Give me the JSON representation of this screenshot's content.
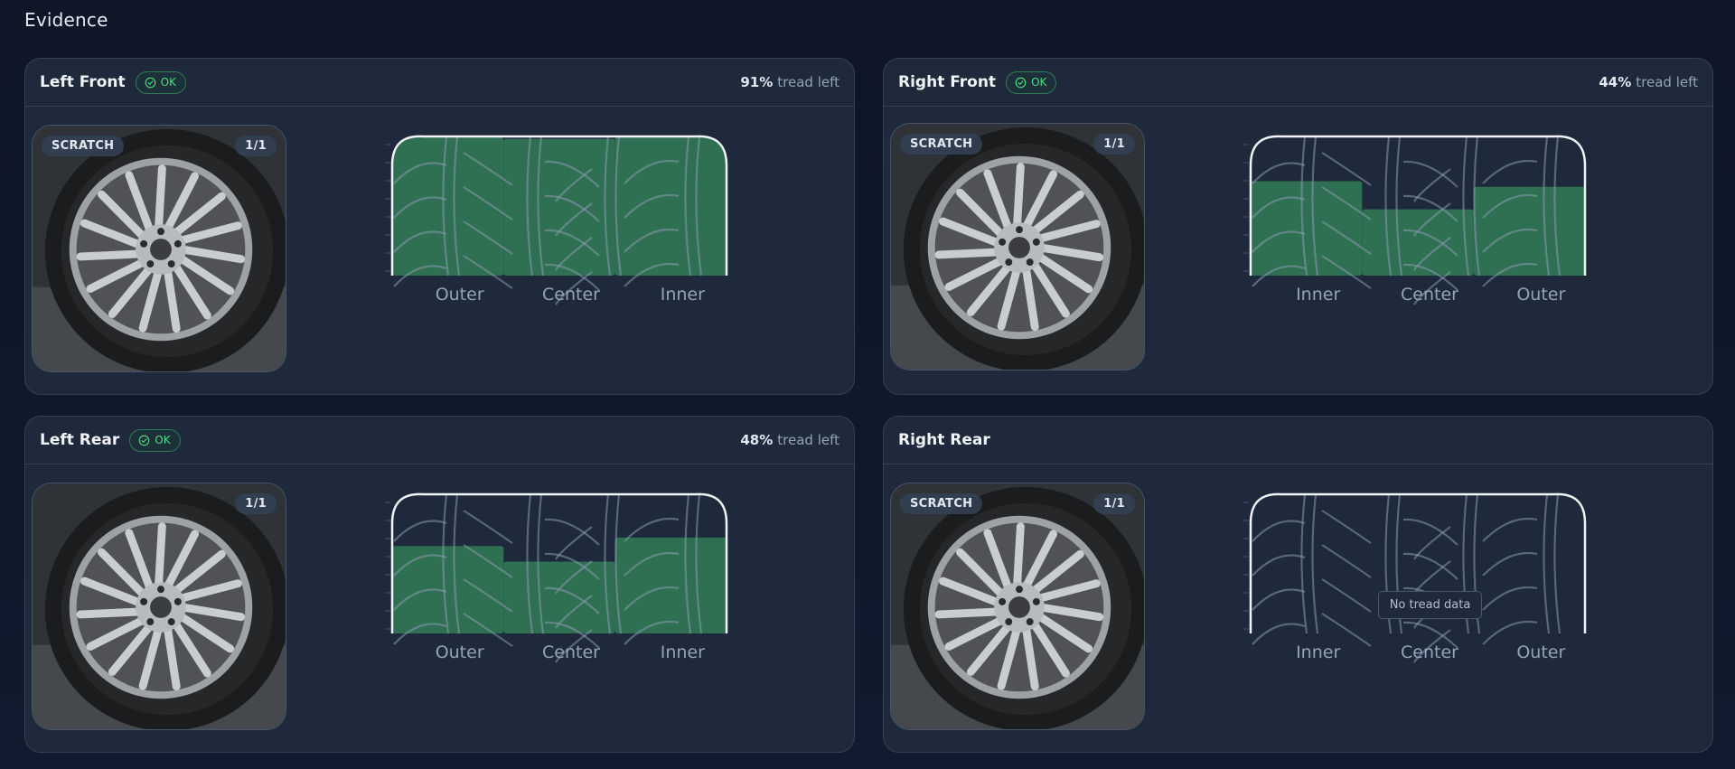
{
  "page": {
    "title": "Evidence"
  },
  "colors": {
    "fill": "#2f6f52",
    "ok": "#4ade80",
    "card": "#1e293b",
    "border": "#334155"
  },
  "cards": [
    {
      "id": "left-front",
      "title": "Left Front",
      "status": "OK",
      "tread_pct": "91%",
      "tread_label": "tread left",
      "photo": {
        "source": "SCRATCH",
        "count": "1/1"
      },
      "tread_zones": [
        "Outer",
        "Center",
        "Inner"
      ],
      "tread_levels": [
        0.98,
        0.97,
        0.99
      ]
    },
    {
      "id": "right-front",
      "title": "Right Front",
      "status": "OK",
      "tread_pct": "44%",
      "tread_label": "tread left",
      "photo": {
        "source": "SCRATCH",
        "count": "1/1"
      },
      "tread_zones": [
        "Inner",
        "Center",
        "Outer"
      ],
      "tread_levels": [
        0.67,
        0.47,
        0.63
      ]
    },
    {
      "id": "left-rear",
      "title": "Left Rear",
      "status": "OK",
      "tread_pct": "48%",
      "tread_label": "tread left",
      "photo": {
        "source": "",
        "count": "1/1"
      },
      "tread_zones": [
        "Outer",
        "Center",
        "Inner"
      ],
      "tread_levels": [
        0.62,
        0.51,
        0.68
      ]
    },
    {
      "id": "right-rear",
      "title": "Right Rear",
      "status": "",
      "tread_pct": "",
      "tread_label": "",
      "photo": {
        "source": "SCRATCH",
        "count": "1/1"
      },
      "tread_zones": [
        "Inner",
        "Center",
        "Outer"
      ],
      "tread_levels": [],
      "empty_message": "No tread data"
    }
  ]
}
